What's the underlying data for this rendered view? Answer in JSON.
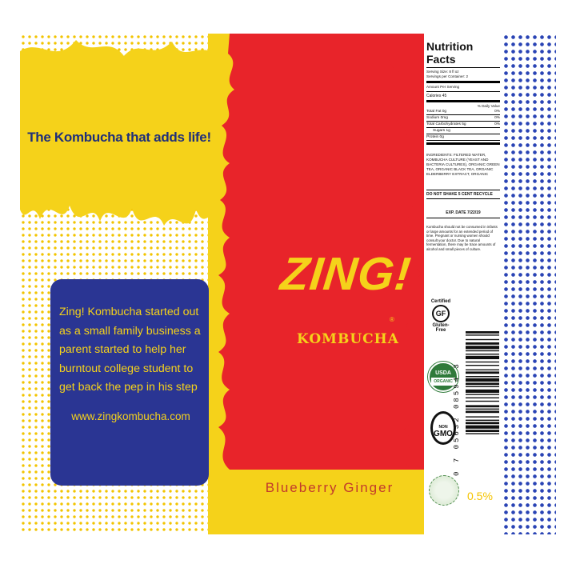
{
  "label": {
    "slogan": "The Kombucha that adds life!",
    "story": {
      "text": "Zing! Kombucha started out as a small family business a parent started to help her burntout college student to get back the pep in his step",
      "url": "www.zingkombucha.com"
    },
    "brand": {
      "name": "ZING!",
      "subname": "KOMBUCHA",
      "registered_mark": "®"
    },
    "flavor": "Blueberry Ginger",
    "abv": "0.5%",
    "colors": {
      "yellow": "#f5d21a",
      "red": "#e8242a",
      "navy": "#2a3593",
      "blue_dots": "#2a44b5",
      "flavor_text": "#c23a2c"
    }
  },
  "nutrition": {
    "title": "Nutrition Facts",
    "serving_size": "Serving Size: 8 fl oz",
    "servings_per_container": "Servings per Container: 2",
    "amount_per_serving": "Amount Per Serving",
    "calories": "Calories 45",
    "daily_value_header": "% Daily Value",
    "rows": [
      {
        "name": "Total Fat 0g",
        "value": "0%",
        "sub": false
      },
      {
        "name": "Sodium 0mg",
        "value": "0%",
        "sub": false
      },
      {
        "name": "Total Carbohydrates 5g",
        "value": "0%",
        "sub": false
      },
      {
        "name": "Sugars 1g",
        "value": "",
        "sub": true
      },
      {
        "name": "Protein 0g",
        "value": "",
        "sub": false
      }
    ],
    "ingredients": "INGREDIENTS: FILTERED WATER, KOMBUCHA CULTURE (YEAST AND BACTERIA CULTURES), ORGANIC GREEN TEA, ORGANIC BLACK TEA, ORGANIC ELDERBERRY EXTRACT, ORGANIC",
    "notice": "DO NOT SHAKE  5 CENT RECYCLE",
    "exp_date": "EXP. DATE  7/22/19",
    "warning": "Kombucha should not be consumed in infants or large amounts for an extended period of time. Pregnant or nursing women should consult your doctor. Due to natural fermentation, there may be trace amounts of alcohol and small pieces of culture."
  },
  "certifications": {
    "gluten_free_top": "Certified",
    "gluten_free_mark": "GF",
    "gluten_free_bottom": "Gluten-Free",
    "usda_top": "USDA",
    "usda_bottom": "ORGANIC",
    "nongmo_top": "NON",
    "nongmo_bottom": "GMO"
  },
  "barcode": {
    "digits": "0 7 05632 08594 3"
  }
}
